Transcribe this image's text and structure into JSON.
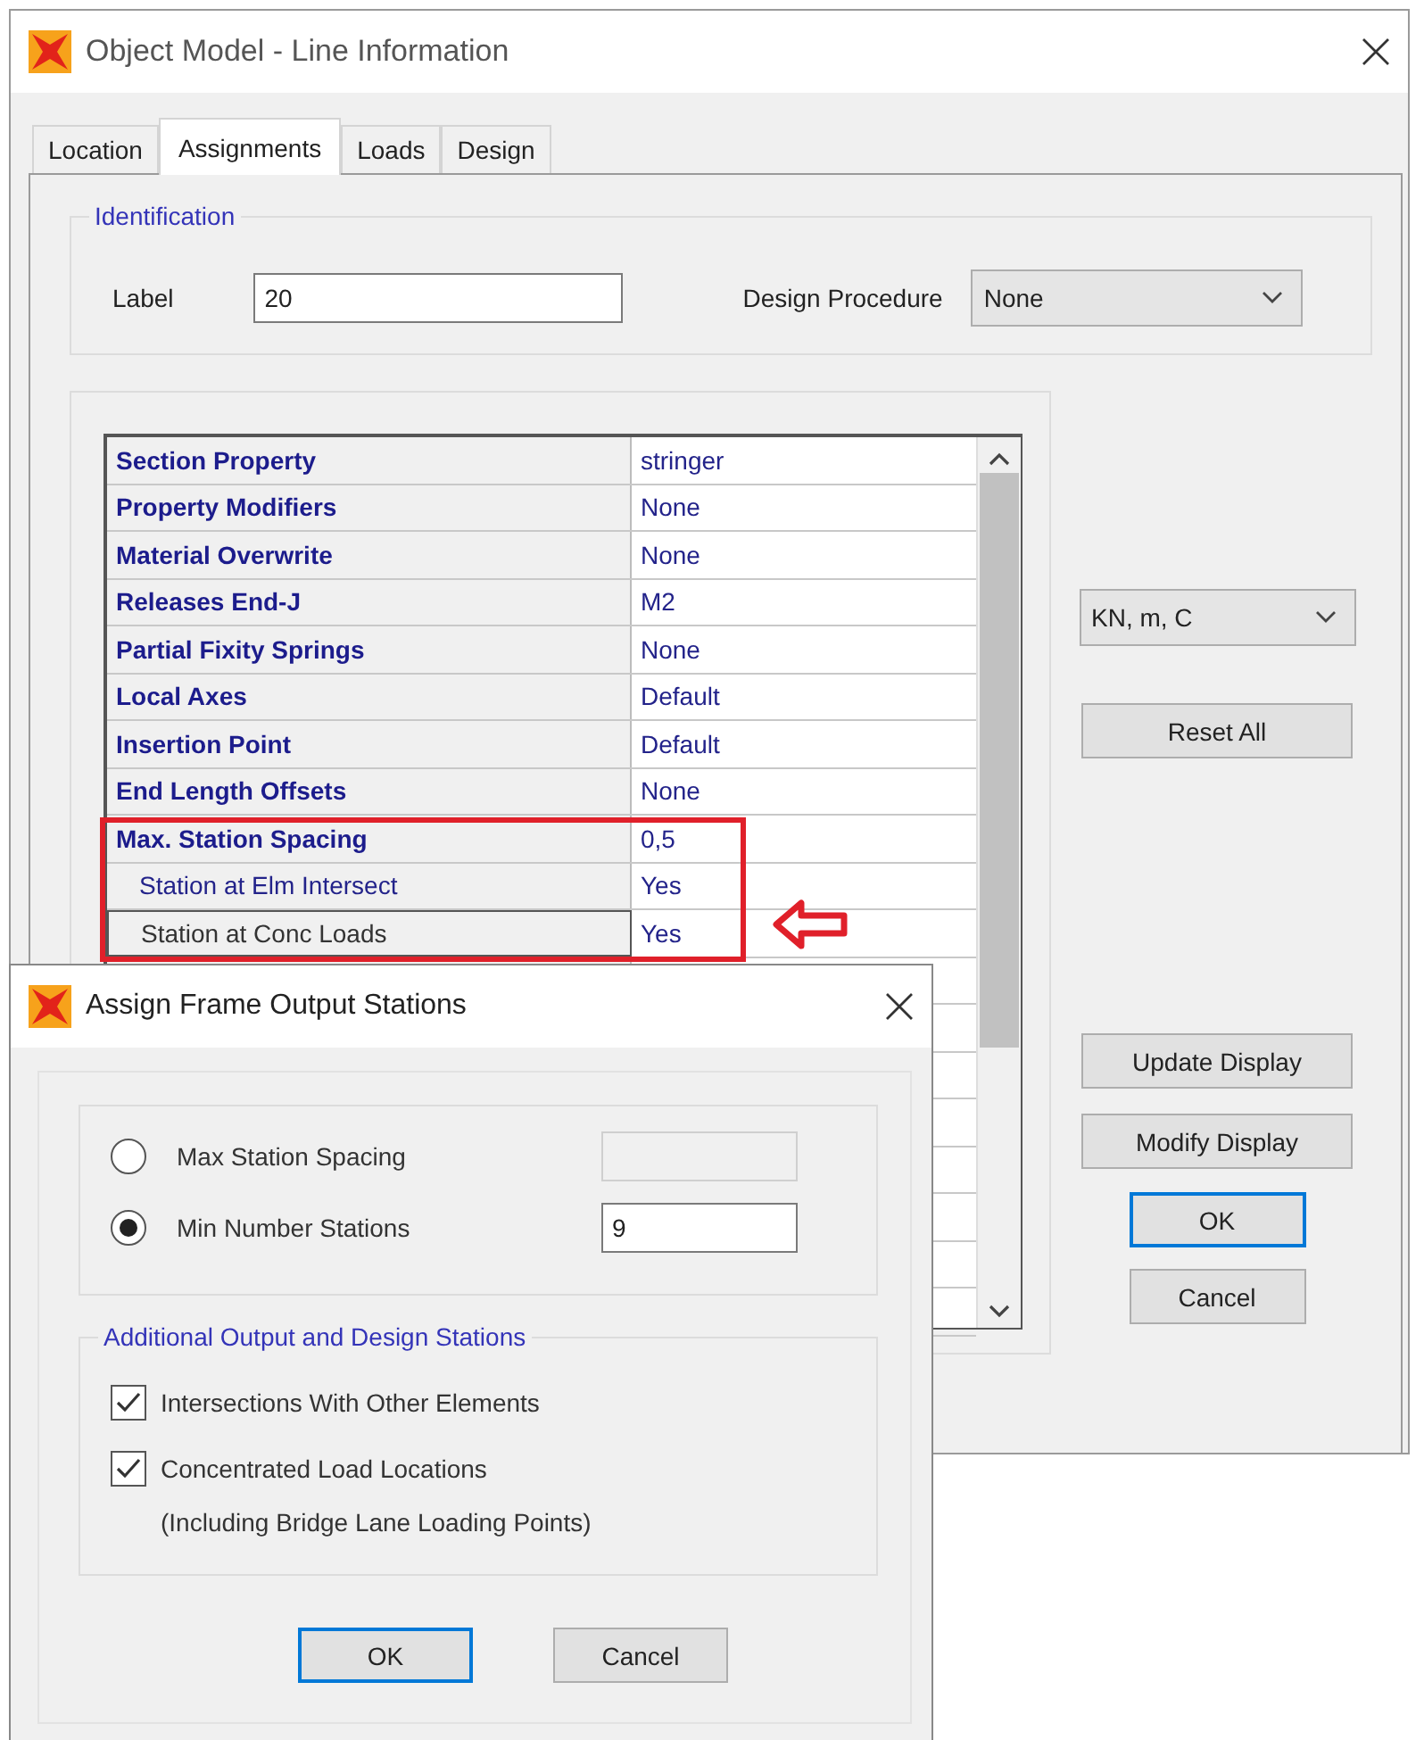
{
  "main_window": {
    "title": "Object Model - Line Information",
    "tabs": [
      {
        "label": "Location",
        "selected": false
      },
      {
        "label": "Assignments",
        "selected": true
      },
      {
        "label": "Loads",
        "selected": false
      },
      {
        "label": "Design",
        "selected": false
      }
    ],
    "identification": {
      "legend": "Identification",
      "label_caption": "Label",
      "label_value": "20",
      "design_procedure_caption": "Design Procedure",
      "design_procedure_value": "None"
    },
    "properties": [
      {
        "name": "Section Property",
        "value": "stringer",
        "kind": "main",
        "selected": false
      },
      {
        "name": "Property Modifiers",
        "value": "None",
        "kind": "main",
        "selected": false
      },
      {
        "name": "Material Overwrite",
        "value": "None",
        "kind": "main",
        "selected": false
      },
      {
        "name": "Releases End-J",
        "value": "M2",
        "kind": "main",
        "selected": false
      },
      {
        "name": "Partial Fixity Springs",
        "value": "None",
        "kind": "main",
        "selected": false
      },
      {
        "name": "Local Axes",
        "value": "Default",
        "kind": "main",
        "selected": false
      },
      {
        "name": "Insertion Point",
        "value": "Default",
        "kind": "main",
        "selected": false
      },
      {
        "name": "End Length Offsets",
        "value": "None",
        "kind": "main",
        "selected": false
      },
      {
        "name": "Max. Station Spacing",
        "value": "0,5",
        "kind": "main",
        "selected": false
      },
      {
        "name": "Station at Elm Intersect",
        "value": "Yes",
        "kind": "sub",
        "selected": false
      },
      {
        "name": "Station at Conc Loads",
        "value": "Yes",
        "kind": "sub",
        "selected": true
      }
    ],
    "units": "KN, m, C",
    "buttons": [
      {
        "label": "Reset All",
        "default": false
      },
      {
        "label": "Update Display",
        "default": false
      },
      {
        "label": "Modify Display",
        "default": false
      },
      {
        "label": "OK",
        "default": true
      },
      {
        "label": "Cancel",
        "default": false
      }
    ]
  },
  "dialog": {
    "title": "Assign Frame Output Stations",
    "options": [
      {
        "label": "Max Station Spacing",
        "selected": false
      },
      {
        "label": "Min Number Stations",
        "selected": true,
        "value": "9"
      }
    ],
    "additional": {
      "legend": "Additional Output and Design Stations",
      "checks": [
        {
          "label": "Intersections With Other Elements",
          "checked": true
        },
        {
          "label": "Concentrated Load Locations",
          "checked": true
        }
      ],
      "note": "(Including Bridge Lane Loading Points)"
    },
    "buttons": [
      {
        "label": "OK",
        "default": true
      },
      {
        "label": "Cancel",
        "default": false
      }
    ]
  }
}
